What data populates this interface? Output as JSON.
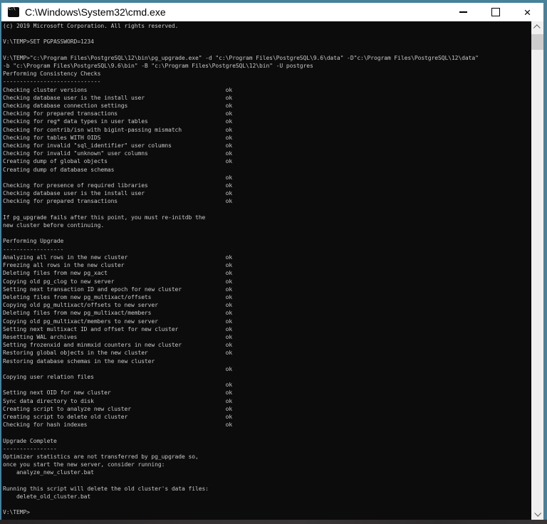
{
  "colors": {
    "accent": "#47819b",
    "titlebar_bg": "#ffffff",
    "console_bg": "#0c0c0c",
    "console_fg": "#c8c8c8",
    "scroll_track": "#f0f0f0",
    "scroll_thumb": "#cdcdcd"
  },
  "window": {
    "title": "C:\\Windows\\System32\\cmd.exe",
    "icon_label": "C:\\",
    "controls": {
      "close_glyph": "×"
    }
  },
  "console": {
    "pad_width": 66,
    "status_ok": "ok",
    "lines": [
      "(c) 2019 Microsoft Corporation. All rights reserved.",
      "",
      "V:\\TEMP>SET PGPASSWORD=1234",
      "",
      "V:\\TEMP>\"c:\\Program Files\\PostgreSQL\\12\\bin\\pg_upgrade.exe\" -d \"c:\\Program Files\\PostgreSQL\\9.6\\data\" -D\"c:\\Program Files\\PostgreSQL\\12\\data\"",
      "-b \"c:\\Program Files\\PostgreSQL\\9.6\\bin\" -B \"c:\\Program Files\\PostgreSQL\\12\\bin\" -U postgres",
      "Performing Consistency Checks",
      "-----------------------------",
      [
        "Checking cluster versions",
        "ok"
      ],
      [
        "Checking database user is the install user",
        "ok"
      ],
      [
        "Checking database connection settings",
        "ok"
      ],
      [
        "Checking for prepared transactions",
        "ok"
      ],
      [
        "Checking for reg* data types in user tables",
        "ok"
      ],
      [
        "Checking for contrib/isn with bigint-passing mismatch",
        "ok"
      ],
      [
        "Checking for tables WITH OIDS",
        "ok"
      ],
      [
        "Checking for invalid \"sql_identifier\" user columns",
        "ok"
      ],
      [
        "Checking for invalid \"unknown\" user columns",
        "ok"
      ],
      [
        "Creating dump of global objects",
        "ok"
      ],
      "Creating dump of database schemas",
      [
        "",
        "ok"
      ],
      [
        "Checking for presence of required libraries",
        "ok"
      ],
      [
        "Checking database user is the install user",
        "ok"
      ],
      [
        "Checking for prepared transactions",
        "ok"
      ],
      "",
      "If pg_upgrade fails after this point, you must re-initdb the",
      "new cluster before continuing.",
      "",
      "Performing Upgrade",
      "------------------",
      [
        "Analyzing all rows in the new cluster",
        "ok"
      ],
      [
        "Freezing all rows in the new cluster",
        "ok"
      ],
      [
        "Deleting files from new pg_xact",
        "ok"
      ],
      [
        "Copying old pg_clog to new server",
        "ok"
      ],
      [
        "Setting next transaction ID and epoch for new cluster",
        "ok"
      ],
      [
        "Deleting files from new pg_multixact/offsets",
        "ok"
      ],
      [
        "Copying old pg_multixact/offsets to new server",
        "ok"
      ],
      [
        "Deleting files from new pg_multixact/members",
        "ok"
      ],
      [
        "Copying old pg_multixact/members to new server",
        "ok"
      ],
      [
        "Setting next multixact ID and offset for new cluster",
        "ok"
      ],
      [
        "Resetting WAL archives",
        "ok"
      ],
      [
        "Setting frozenxid and minmxid counters in new cluster",
        "ok"
      ],
      [
        "Restoring global objects in the new cluster",
        "ok"
      ],
      "Restoring database schemas in the new cluster",
      [
        "",
        "ok"
      ],
      "Copying user relation files",
      [
        "",
        "ok"
      ],
      [
        "Setting next OID for new cluster",
        "ok"
      ],
      [
        "Sync data directory to disk",
        "ok"
      ],
      [
        "Creating script to analyze new cluster",
        "ok"
      ],
      [
        "Creating script to delete old cluster",
        "ok"
      ],
      [
        "Checking for hash indexes",
        "ok"
      ],
      "",
      "Upgrade Complete",
      "----------------",
      "Optimizer statistics are not transferred by pg_upgrade so,",
      "once you start the new server, consider running:",
      "    analyze_new_cluster.bat",
      "",
      "Running this script will delete the old cluster's data files:",
      "    delete_old_cluster.bat",
      "",
      "V:\\TEMP>"
    ]
  }
}
